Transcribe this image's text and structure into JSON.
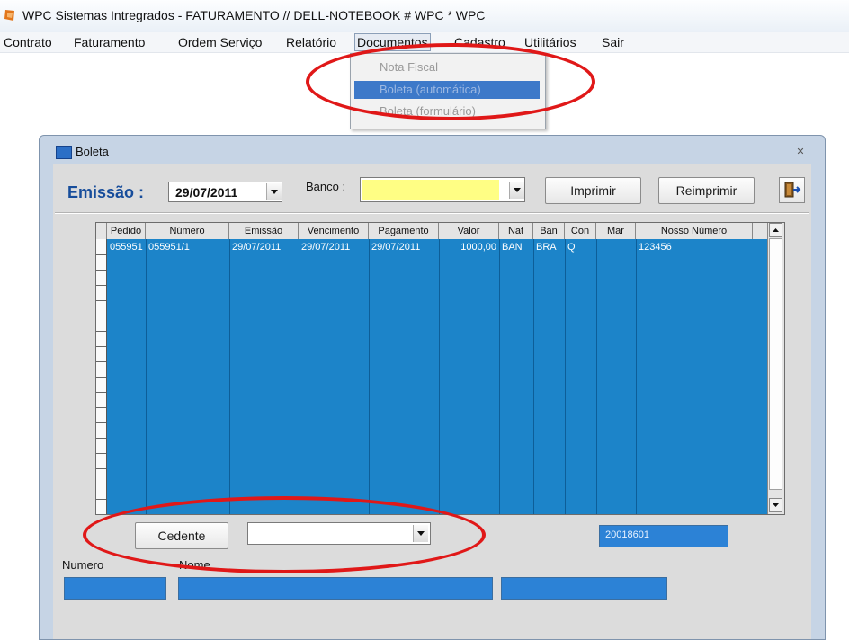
{
  "title_bar": {
    "title": "WPC Sistemas Intregrados - FATURAMENTO // DELL-NOTEBOOK # WPC  * WPC"
  },
  "menu": {
    "items": [
      "Contrato",
      "Faturamento",
      "Ordem Serviço",
      "Relatório",
      "Documentos",
      "Cadastro",
      "Utilitários",
      "Sair"
    ],
    "active": "Documentos"
  },
  "dropdown": {
    "items": [
      "Nota Fiscal",
      "Boleta (automática)",
      "Boleta (formulário)"
    ]
  },
  "window": {
    "title": "Boleta",
    "close_glyph": "✕"
  },
  "toolbar": {
    "emissao_label": "Emissão :",
    "emissao_value": "29/07/2011",
    "banco_label": "Banco :",
    "banco_value": "",
    "imprimir_label": "Imprimir",
    "reimprimir_label": "Reimprimir"
  },
  "grid": {
    "columns": [
      "Pedido",
      "Número",
      "Emissão",
      "Vencimento",
      "Pagamento",
      "Valor",
      "Nat",
      "Ban",
      "Con",
      "Mar",
      "Nosso Número"
    ],
    "rows": [
      [
        "055951",
        "055951/1",
        "29/07/2011",
        "29/07/2011",
        "29/07/2011",
        "1000,00",
        "BAN",
        "BRA",
        "Q",
        "",
        "123456"
      ]
    ]
  },
  "bottom": {
    "cedente_label": "Cedente",
    "cedente_value": "",
    "code_value": "20018601",
    "numero_label": "Numero",
    "nome_label": "Nome"
  },
  "colors": {
    "grid_bg": "#1c84c9",
    "highlight_ellipse": "#e01818",
    "emissao_label": "#174d9b",
    "banco_field": "#fffe84"
  }
}
